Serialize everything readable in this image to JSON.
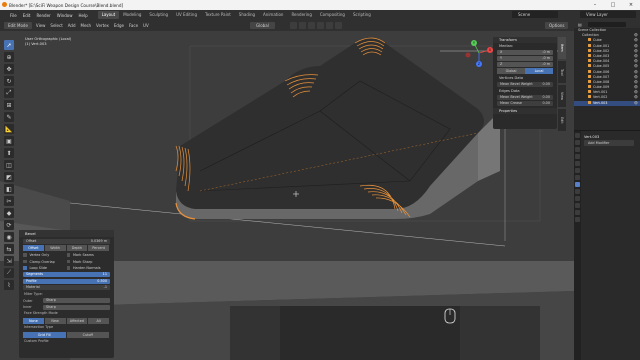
{
  "window": {
    "title": "Blender* [E:\\SciFi Weapon Design Course\\Blend.blend]"
  },
  "menu": [
    "File",
    "Edit",
    "Render",
    "Window",
    "Help"
  ],
  "workspaces": [
    "Layout",
    "Modeling",
    "Sculpting",
    "UV Editing",
    "Texture Paint",
    "Shading",
    "Animation",
    "Rendering",
    "Compositing",
    "Scripting"
  ],
  "active_workspace": "Layout",
  "scene": {
    "label": "Scene",
    "view_layer": "View Layer"
  },
  "viewport_header": {
    "mode": "Edit Mode",
    "items": [
      "View",
      "Select",
      "Add",
      "Mesh",
      "Vertex",
      "Edge",
      "Face",
      "UV"
    ],
    "orientation": "Global",
    "options": "Options"
  },
  "viewport": {
    "view_name": "User Orthographic (Local)",
    "object_name": "(1) Vert.003",
    "gizmo": {
      "x": "X",
      "y": "Y",
      "z": "Z"
    }
  },
  "toolbar": [
    "cursor-select",
    "cursor",
    "move",
    "rotate",
    "scale",
    "transform",
    "annotate",
    "measure",
    "add-cube",
    "extrude",
    "inset",
    "bevel",
    "loopcut",
    "knife",
    "polybuild",
    "spin",
    "smooth",
    "edge-slide",
    "shrink",
    "shear",
    "rip"
  ],
  "npanel": {
    "transform_title": "Transform",
    "median_label": "Median:",
    "median": [
      {
        "k": "X",
        "v": "-0 m"
      },
      {
        "k": "Y",
        "v": "-0 m"
      },
      {
        "k": "Z",
        "v": "-0 m"
      }
    ],
    "space": [
      "Global",
      "Local"
    ],
    "active_space": "Local",
    "vertices_data": "Vertices Data",
    "vertex_bevel": {
      "label": "Mean Bevel Weight",
      "value": "0.00"
    },
    "edges_data": "Edges Data",
    "edge_bevel": {
      "label": "Mean Bevel Weight",
      "value": "0.00"
    },
    "edge_crease": {
      "label": "Mean Crease",
      "value": "0.00"
    },
    "properties": "Properties",
    "tabs": [
      "Item",
      "Tool",
      "View",
      "Edit"
    ]
  },
  "bevel": {
    "title": "Bevel",
    "offset": {
      "label": "Offset",
      "value": "0.0369 m"
    },
    "width_type": [
      "Offset",
      "Width",
      "Depth",
      "Percent"
    ],
    "active_width_type": "Offset",
    "checks": [
      {
        "label": "Vertex Only",
        "on": false
      },
      {
        "label": "Mark Seams",
        "on": false
      },
      {
        "label": "Clamp Overlap",
        "on": false
      },
      {
        "label": "Mark Sharp",
        "on": false
      },
      {
        "label": "Loop Slide",
        "on": true
      },
      {
        "label": "Harden Normals",
        "on": false
      }
    ],
    "segments": {
      "label": "Segments",
      "value": "11"
    },
    "profile": {
      "label": "Profile",
      "value": "0.500"
    },
    "material": {
      "label": "Material",
      "value": "-1"
    },
    "miter_type": "Miter Type:",
    "outer": {
      "label": "Outer",
      "value": "Sharp"
    },
    "inner": {
      "label": "Inner",
      "value": "Sharp"
    },
    "face_strength": "Face Strength Mode",
    "face_strength_modes": [
      "None",
      "New",
      "Affected",
      "All"
    ],
    "active_face_strength": "None",
    "intersection": "Intersection Type",
    "intersection_modes": [
      "Grid Fill",
      "Cutoff"
    ],
    "active_intersection": "Grid Fill",
    "custom_profile": "Custom Profile"
  },
  "outliner": {
    "root": "Scene Collection",
    "collection": "Collection",
    "items": [
      "Cube",
      "Cube.001",
      "Cube.002",
      "Cube.003",
      "Cube.004",
      "Cube.005",
      "Cube.006",
      "Cube.007",
      "Cube.008",
      "Cube.009",
      "Vert.001",
      "Vert.002",
      "Vert.003"
    ],
    "selected": "Vert.003"
  },
  "properties": {
    "object": "Vert.003",
    "add_modifier": "Add Modifier"
  },
  "colors": {
    "accent": "#4772b3",
    "bevel_highlight": "#e8913a",
    "mesh_face": "#3a3a3a",
    "viewport_bg": "#3d3d3d"
  }
}
